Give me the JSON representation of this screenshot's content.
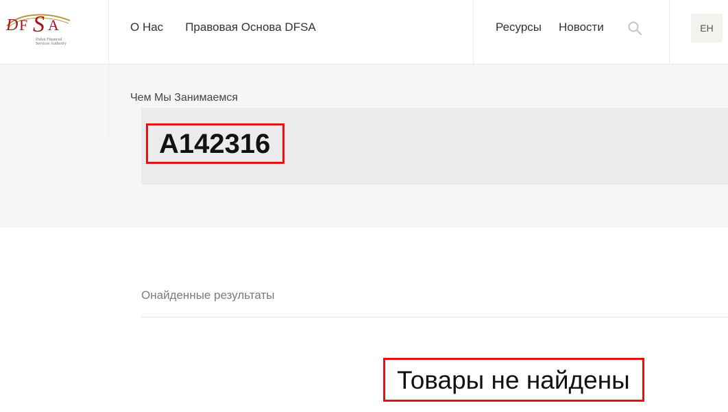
{
  "header": {
    "logo": {
      "brand": "DFSA",
      "subtitle_line1": "Dubai Financial",
      "subtitle_line2": "Services Authority"
    },
    "nav_left": [
      {
        "label": "О Нас"
      },
      {
        "label": "Правовая Основа DFSA"
      }
    ],
    "nav_right": [
      {
        "label": "Ресурсы"
      },
      {
        "label": "Новости"
      }
    ],
    "search_icon": "search-icon",
    "language": "EH"
  },
  "band": {
    "breadcrumb": "Чем Мы Занимаемся",
    "query": "A142316"
  },
  "results": {
    "label": "Онайденные результаты",
    "empty_message": "Товары не найдены"
  },
  "colors": {
    "highlight_border": "#e41212",
    "logo_red": "#a3151b",
    "logo_gold": "#b89443"
  }
}
